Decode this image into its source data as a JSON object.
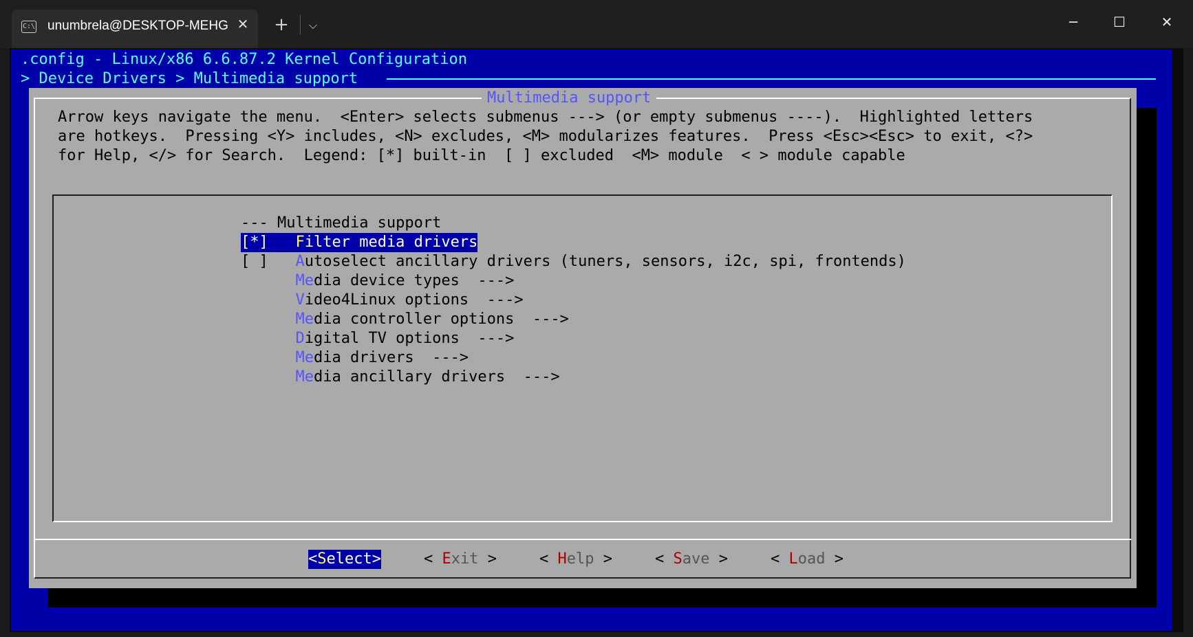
{
  "window": {
    "tab_title": "unumbrela@DESKTOP-MEHGI",
    "tab_icon_text": "C:\\",
    "close_tab": "✕",
    "new_tab": "+",
    "dropdown": "⌵",
    "minimize": "─",
    "maximize": "☐",
    "close": "✕"
  },
  "terminal": {
    "config_title": ".config - Linux/x86 6.6.87.2 Kernel Configuration",
    "breadcrumb": "> Device Drivers > Multimedia support"
  },
  "dialog": {
    "title": "Multimedia support",
    "help_lines": [
      "Arrow keys navigate the menu.  <Enter> selects submenus ---> (or empty submenus ----).  Highlighted letters",
      "are hotkeys.  Pressing <Y> includes, <N> excludes, <M> modularizes features.  Press <Esc><Esc> to exit, <?>",
      "for Help, </> for Search.  Legend: [*] built-in  [ ] excluded  <M> module  < > module capable"
    ],
    "menu": {
      "items": [
        {
          "prefix": "--- ",
          "hot": "",
          "rest": "Multimedia support",
          "selected": false
        },
        {
          "prefix": "[*]   ",
          "hot": "F",
          "rest": "ilter media drivers",
          "selected": true
        },
        {
          "prefix": "[ ]   ",
          "hot": "A",
          "rest": "utoselect ancillary drivers (tuners, sensors, i2c, spi, frontends)",
          "selected": false
        },
        {
          "prefix": "      ",
          "hot": "M",
          "rest": "edia device types  --->",
          "selected": false,
          "hot2": "e"
        },
        {
          "prefix": "      ",
          "hot": "V",
          "rest": "ideo4Linux options  --->",
          "selected": false,
          "hot2": "e"
        },
        {
          "prefix": "      ",
          "hot": "M",
          "rest": "edia controller options  --->",
          "selected": false,
          "hot2": "e"
        },
        {
          "prefix": "      ",
          "hot": "D",
          "rest": "igital TV options  --->",
          "selected": false
        },
        {
          "prefix": "      ",
          "hot": "M",
          "rest": "edia drivers  --->",
          "selected": false,
          "hot2": "e"
        },
        {
          "prefix": "      ",
          "hot": "M",
          "rest": "edia ancillary drivers  --->",
          "selected": false,
          "hot2": "e"
        }
      ]
    },
    "buttons": [
      {
        "open": "<",
        "hot": "S",
        "rest": "elect",
        "close": ">",
        "selected": true
      },
      {
        "open": "< ",
        "hot": "E",
        "rest": "xit",
        "close": " >",
        "selected": false
      },
      {
        "open": "< ",
        "hot": "H",
        "rest": "elp",
        "close": " >",
        "selected": false
      },
      {
        "open": "< ",
        "hot": "S",
        "rest": "ave",
        "close": " >",
        "selected": false
      },
      {
        "open": "< ",
        "hot": "L",
        "rest": "oad",
        "close": " >",
        "selected": false
      }
    ]
  }
}
